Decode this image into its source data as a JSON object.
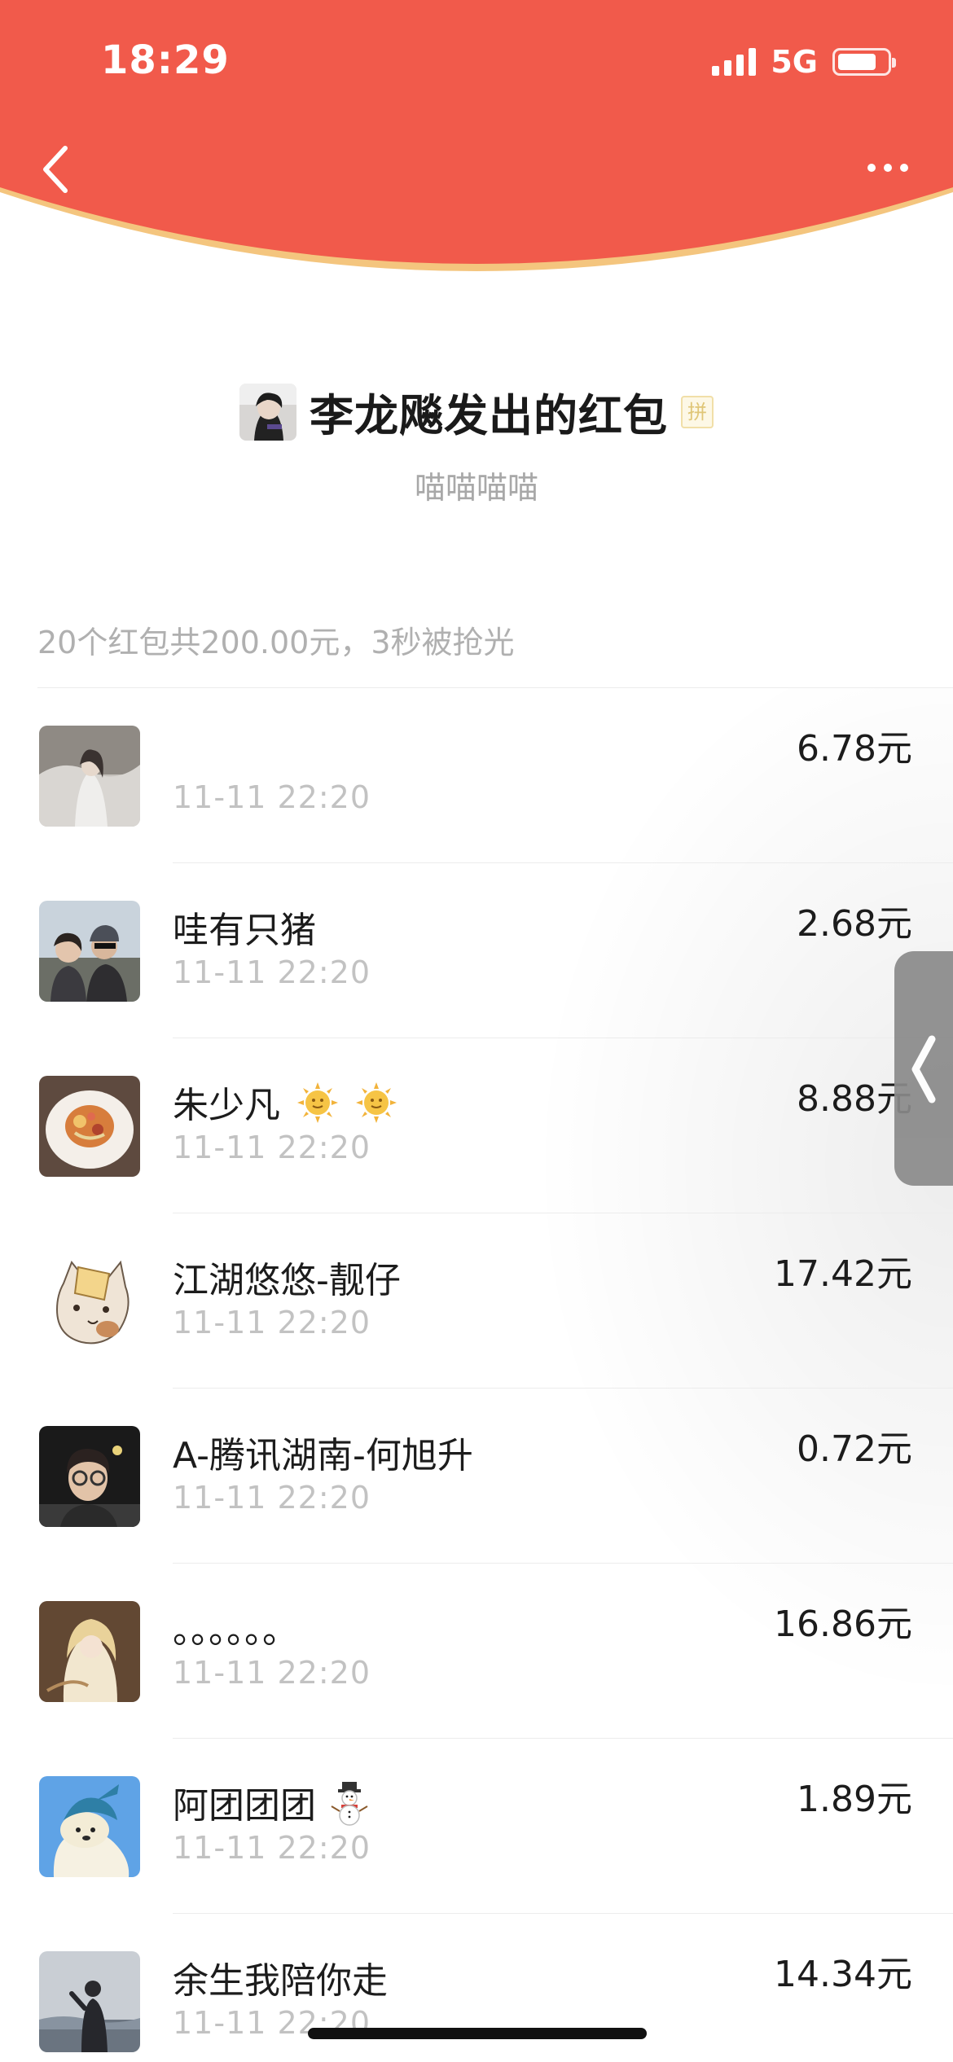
{
  "status_bar": {
    "time": "18:29",
    "network": "5G",
    "battery_level": 0.8
  },
  "sender": {
    "title": "李龙飚发出的红包",
    "pin_badge": "拼",
    "blessing": "喵喵喵喵"
  },
  "summary": "20个红包共200.00元，3秒被抢光",
  "records": [
    {
      "name": "",
      "time": "11-11 22:20",
      "amount": "6.78元"
    },
    {
      "name": "哇有只猪",
      "time": "11-11 22:20",
      "amount": "2.68元"
    },
    {
      "name": "朱少凡",
      "emoji": "sun-face-icon",
      "time": "11-11 22:20",
      "amount": "8.88元"
    },
    {
      "name": "江湖悠悠-靓仔",
      "time": "11-11 22:20",
      "amount": "17.42元"
    },
    {
      "name": "A-腾讯湖南-何旭升",
      "time": "11-11 22:20",
      "amount": "0.72元"
    },
    {
      "name": "。。。。。。",
      "time": "11-11 22:20",
      "amount": "16.86元"
    },
    {
      "name": "阿团团团",
      "emoji": "snowman-icon",
      "time": "11-11 22:20",
      "amount": "1.89元"
    },
    {
      "name": "余生我陪你走",
      "time": "11-11 22:20",
      "amount": "14.34元"
    }
  ],
  "colors": {
    "header_red": "#F15A4B",
    "header_rim": "#F4C57E",
    "divider": "#ECECEC",
    "muted_text": "#B0B0B0"
  }
}
